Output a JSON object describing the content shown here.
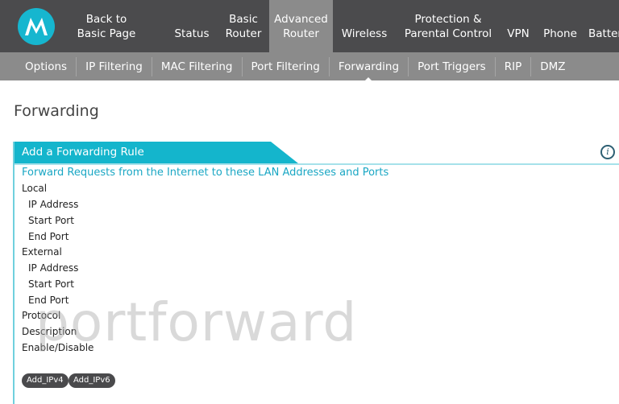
{
  "header": {
    "logo": "motorola-logo",
    "nav": [
      {
        "label1": "Back to",
        "label2": "Basic Page"
      },
      {
        "label1": "",
        "label2": "Status"
      },
      {
        "label1": "Basic",
        "label2": "Router"
      },
      {
        "label1": "Advanced",
        "label2": "Router",
        "active": true
      },
      {
        "label1": "",
        "label2": "Wireless"
      },
      {
        "label1": "Protection &",
        "label2": "Parental Control"
      },
      {
        "label1": "",
        "label2": "VPN"
      },
      {
        "label1": "",
        "label2": "Phone"
      },
      {
        "label1": "",
        "label2": "Battery"
      }
    ]
  },
  "subnav": [
    "Options",
    "IP Filtering",
    "MAC Filtering",
    "Port Filtering",
    "Forwarding",
    "Port Triggers",
    "RIP",
    "DMZ"
  ],
  "subnav_active": "Forwarding",
  "page_title": "Forwarding",
  "panel": {
    "title": "Add a Forwarding Rule",
    "info_icon": "info-icon",
    "subtitle": "Forward Requests from the Internet to these LAN Addresses and Ports",
    "rows": [
      "Local",
      "IP Address",
      "Start Port",
      "End Port",
      "External",
      "IP Address",
      "Start Port",
      "End Port",
      "Protocol",
      "Description",
      "Enable/Disable"
    ],
    "buttons": [
      "Add_IPv4",
      "Add_IPv6"
    ]
  },
  "watermark": "portforward",
  "colors": {
    "header": "#4b4b4d",
    "subnav": "#8b8b8b",
    "accent": "#14b5cc"
  }
}
